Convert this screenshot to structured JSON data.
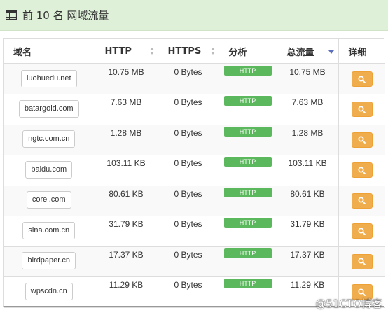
{
  "panel": {
    "title": "前 10 名 网域流量",
    "icon": "table-icon"
  },
  "table": {
    "columns": [
      {
        "label": "域名",
        "sort": "none"
      },
      {
        "label": "HTTP",
        "sort": "sortable"
      },
      {
        "label": "HTTPS",
        "sort": "sortable"
      },
      {
        "label": "分析",
        "sort": "none"
      },
      {
        "label": "总流量",
        "sort": "desc"
      },
      {
        "label": "详细",
        "sort": "none"
      }
    ],
    "rows": [
      {
        "domain": "luohuedu.net",
        "http": "10.75 MB",
        "https": "0 Bytes",
        "analysis": "HTTP",
        "total": "10.75 MB"
      },
      {
        "domain": "batargold.com",
        "http": "7.63 MB",
        "https": "0 Bytes",
        "analysis": "HTTP",
        "total": "7.63 MB"
      },
      {
        "domain": "ngtc.com.cn",
        "http": "1.28 MB",
        "https": "0 Bytes",
        "analysis": "HTTP",
        "total": "1.28 MB"
      },
      {
        "domain": "baidu.com",
        "http": "103.11 KB",
        "https": "0 Bytes",
        "analysis": "HTTP",
        "total": "103.11 KB"
      },
      {
        "domain": "corel.com",
        "http": "80.61 KB",
        "https": "0 Bytes",
        "analysis": "HTTP",
        "total": "80.61 KB"
      },
      {
        "domain": "sina.com.cn",
        "http": "31.79 KB",
        "https": "0 Bytes",
        "analysis": "HTTP",
        "total": "31.79 KB"
      },
      {
        "domain": "birdpaper.cn",
        "http": "17.37 KB",
        "https": "0 Bytes",
        "analysis": "HTTP",
        "total": "17.37 KB"
      },
      {
        "domain": "wpscdn.cn",
        "http": "11.29 KB",
        "https": "0 Bytes",
        "analysis": "HTTP",
        "total": "11.29 KB"
      }
    ],
    "detail_icon": "search-icon"
  },
  "colors": {
    "header_bg": "#dff0d8",
    "badge": "#5cb85c",
    "detail_button": "#f0ad4e",
    "sort_active": "#5b6fbf"
  },
  "watermark": "@51CTO博客"
}
